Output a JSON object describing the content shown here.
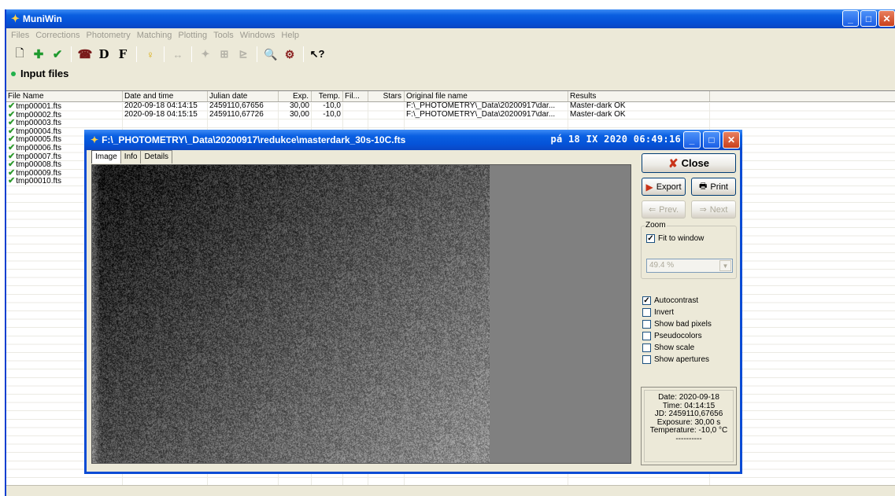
{
  "app": {
    "title": "MuniWin"
  },
  "menu": [
    "Files",
    "Corrections",
    "Photometry",
    "Matching",
    "Plotting",
    "Tools",
    "Windows",
    "Help"
  ],
  "toolbar": {
    "icons": [
      "new-file-icon",
      "add-icon",
      "check-icon",
      "bias-icon",
      "dark-icon",
      "flat-icon",
      "bulb-icon",
      "align-icon",
      "match-icon",
      "table-icon",
      "chart-icon",
      "find-icon",
      "inspect-icon",
      "help-icon"
    ],
    "d_label": "D",
    "f_label": "F"
  },
  "section": {
    "title": "Input files"
  },
  "table": {
    "columns": [
      "File Name",
      "Date and time",
      "Julian date",
      "Exp.",
      "Temp.",
      "Fil...",
      "Stars",
      "Original file name",
      "Results"
    ],
    "rows": [
      [
        "tmp00001.fts",
        "2020-09-18 04:14:15",
        "2459110,67656",
        "30,00",
        "-10,0",
        "",
        "",
        "F:\\_PHOTOMETRY\\_Data\\20200917\\dar...",
        "Master-dark OK"
      ],
      [
        "tmp00002.fts",
        "2020-09-18 04:15:15",
        "2459110,67726",
        "30,00",
        "-10,0",
        "",
        "",
        "F:\\_PHOTOMETRY\\_Data\\20200917\\dar...",
        "Master-dark OK"
      ],
      [
        "tmp00003.fts",
        "",
        "",
        "",
        "",
        "",
        "",
        "",
        ""
      ],
      [
        "tmp00004.fts",
        "",
        "",
        "",
        "",
        "",
        "",
        "",
        ""
      ],
      [
        "tmp00005.fts",
        "",
        "",
        "",
        "",
        "",
        "",
        "",
        ""
      ],
      [
        "tmp00006.fts",
        "",
        "",
        "",
        "",
        "",
        "",
        "",
        ""
      ],
      [
        "tmp00007.fts",
        "",
        "",
        "",
        "",
        "",
        "",
        "",
        ""
      ],
      [
        "tmp00008.fts",
        "",
        "",
        "",
        "",
        "",
        "",
        "",
        ""
      ],
      [
        "tmp00009.fts",
        "",
        "",
        "",
        "",
        "",
        "",
        "",
        ""
      ],
      [
        "tmp00010.fts",
        "",
        "",
        "",
        "",
        "",
        "",
        "",
        ""
      ]
    ]
  },
  "viewer": {
    "title": "F:\\_PHOTOMETRY\\_Data\\20200917\\redukce\\masterdark_30s-10C.fts",
    "clock": "pá 18 IX 2020 06:49:16",
    "tabs": [
      "Image",
      "Info",
      "Details"
    ],
    "close_label": "Close",
    "export_label": "Export",
    "print_label": "Print",
    "prev_label": "Prev.",
    "next_label": "Next",
    "zoom": {
      "label": "Zoom",
      "fit_label": "Fit to window",
      "fit_checked": true,
      "value": "49.4 %"
    },
    "options": [
      {
        "label": "Autocontrast",
        "checked": true
      },
      {
        "label": "Invert",
        "checked": false
      },
      {
        "label": "Show bad pixels",
        "checked": false
      },
      {
        "label": "Pseudocolors",
        "checked": false
      },
      {
        "label": "Show scale",
        "checked": false
      },
      {
        "label": "Show apertures",
        "checked": false
      }
    ],
    "info": {
      "date": "Date: 2020-09-18",
      "time": "Time: 04:14:15",
      "jd": "JD: 2459110,67656",
      "exposure": "Exposure: 30,00 s",
      "temperature": "Temperature: -10,0 °C",
      "dashes": "----------"
    }
  }
}
